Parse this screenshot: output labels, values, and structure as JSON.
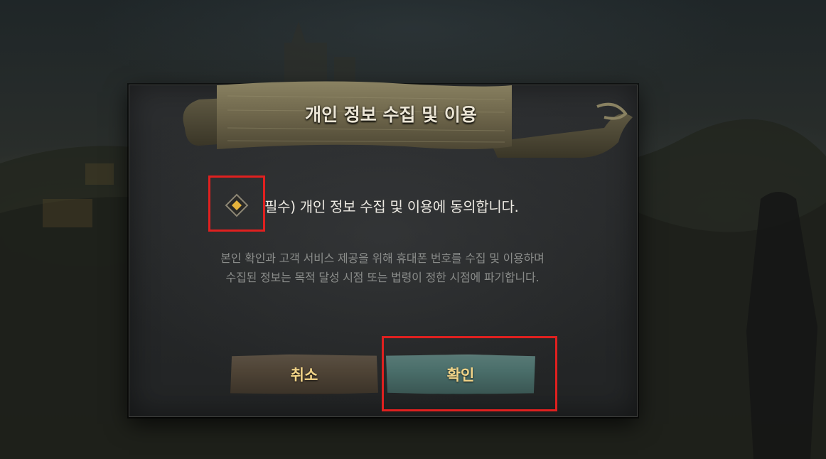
{
  "dialog": {
    "title": "개인 정보 수집 및 이용",
    "consent_label": "필수) 개인 정보 수집 및 이용에 동의합니다.",
    "consent_checked": false,
    "notice_lines": [
      "본인 확인과 고객 서비스 제공을 위해 휴대폰 번호를 수집 및 이용하며",
      "수집된 정보는 목적 달성 시점 또는 법령이 정한 시점에 파기합니다."
    ],
    "cancel_label": "취소",
    "confirm_label": "확인"
  },
  "colors": {
    "highlight": "#e0201f",
    "button_text": "#f2d488",
    "confirm_button": "#4a6e6a",
    "cancel_button": "#4f4436",
    "checkbox_diamond": "#e6b43c"
  },
  "icons": {
    "checkbox": "diamond-checkbox-icon"
  }
}
